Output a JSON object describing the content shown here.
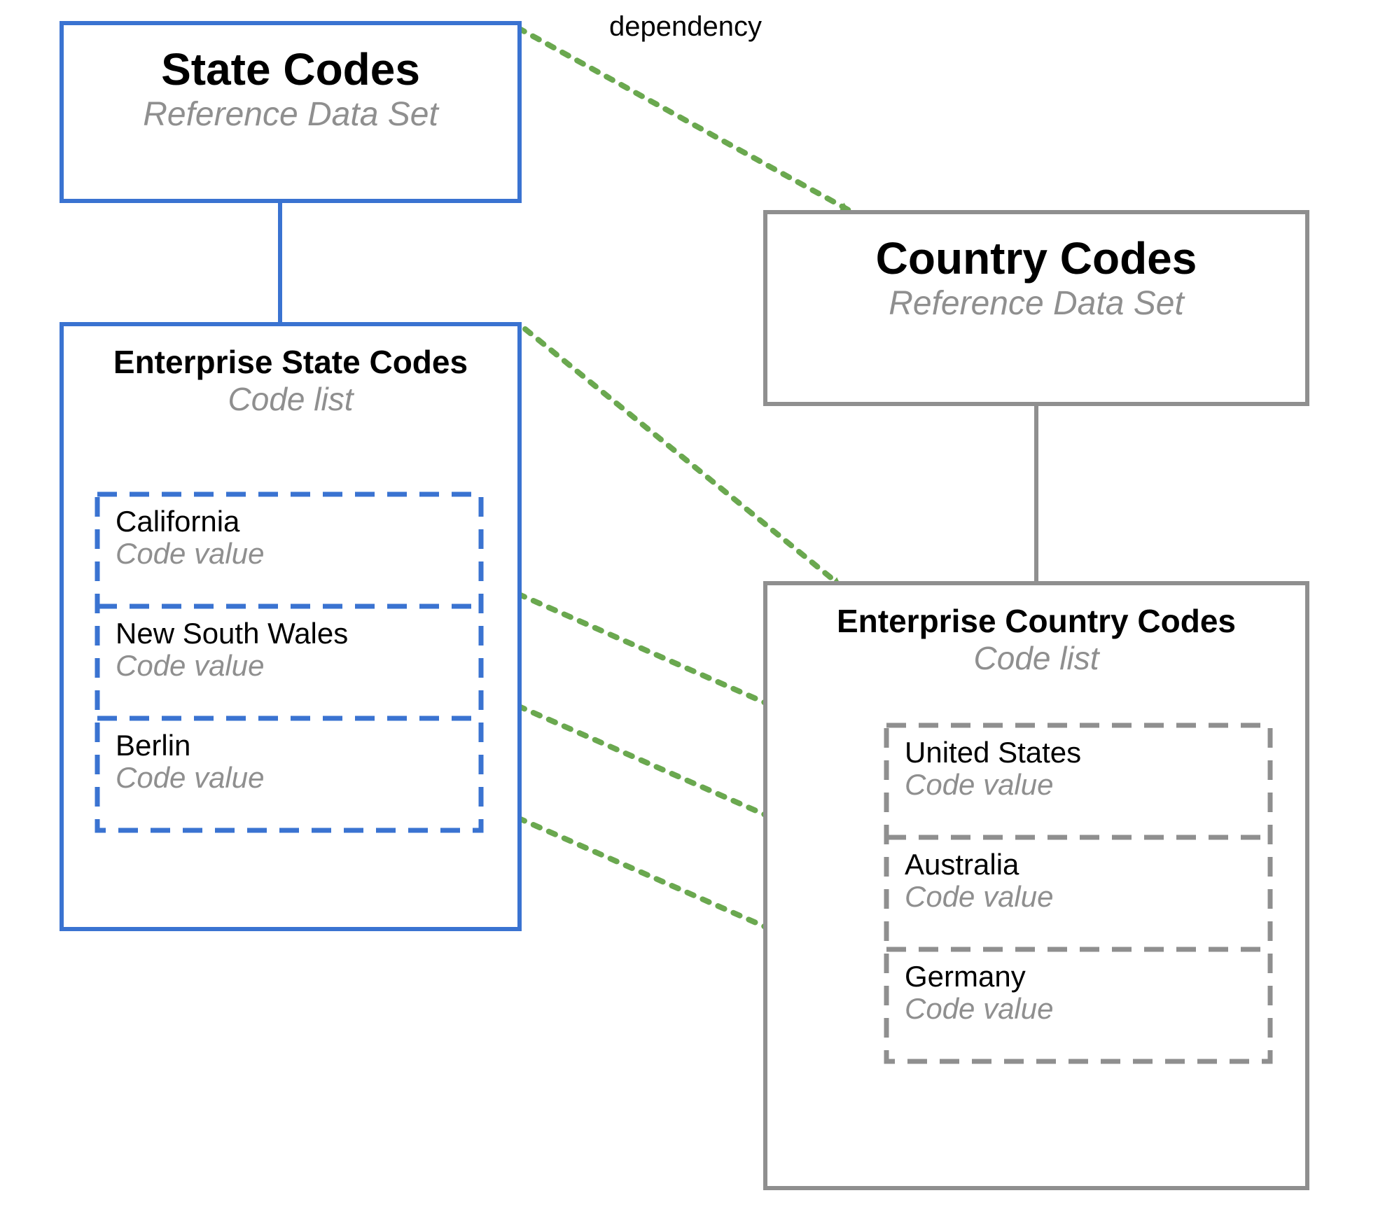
{
  "labels": {
    "dependency": "dependency",
    "code_list": "Code list",
    "code_value": "Code value",
    "reference_data_set": "Reference Data Set"
  },
  "state": {
    "ref_title": "State Codes",
    "codelist_title": "Enterprise State Codes",
    "values": [
      {
        "name": "California"
      },
      {
        "name": "New South Wales"
      },
      {
        "name": "Berlin"
      }
    ]
  },
  "country": {
    "ref_title": "Country Codes",
    "codelist_title": "Enterprise Country Codes",
    "values": [
      {
        "name": "United States"
      },
      {
        "name": "Australia"
      },
      {
        "name": "Germany"
      }
    ]
  },
  "colors": {
    "blue": "#3a73d1",
    "gray": "#8f8f8f",
    "green": "#6aa84f"
  }
}
